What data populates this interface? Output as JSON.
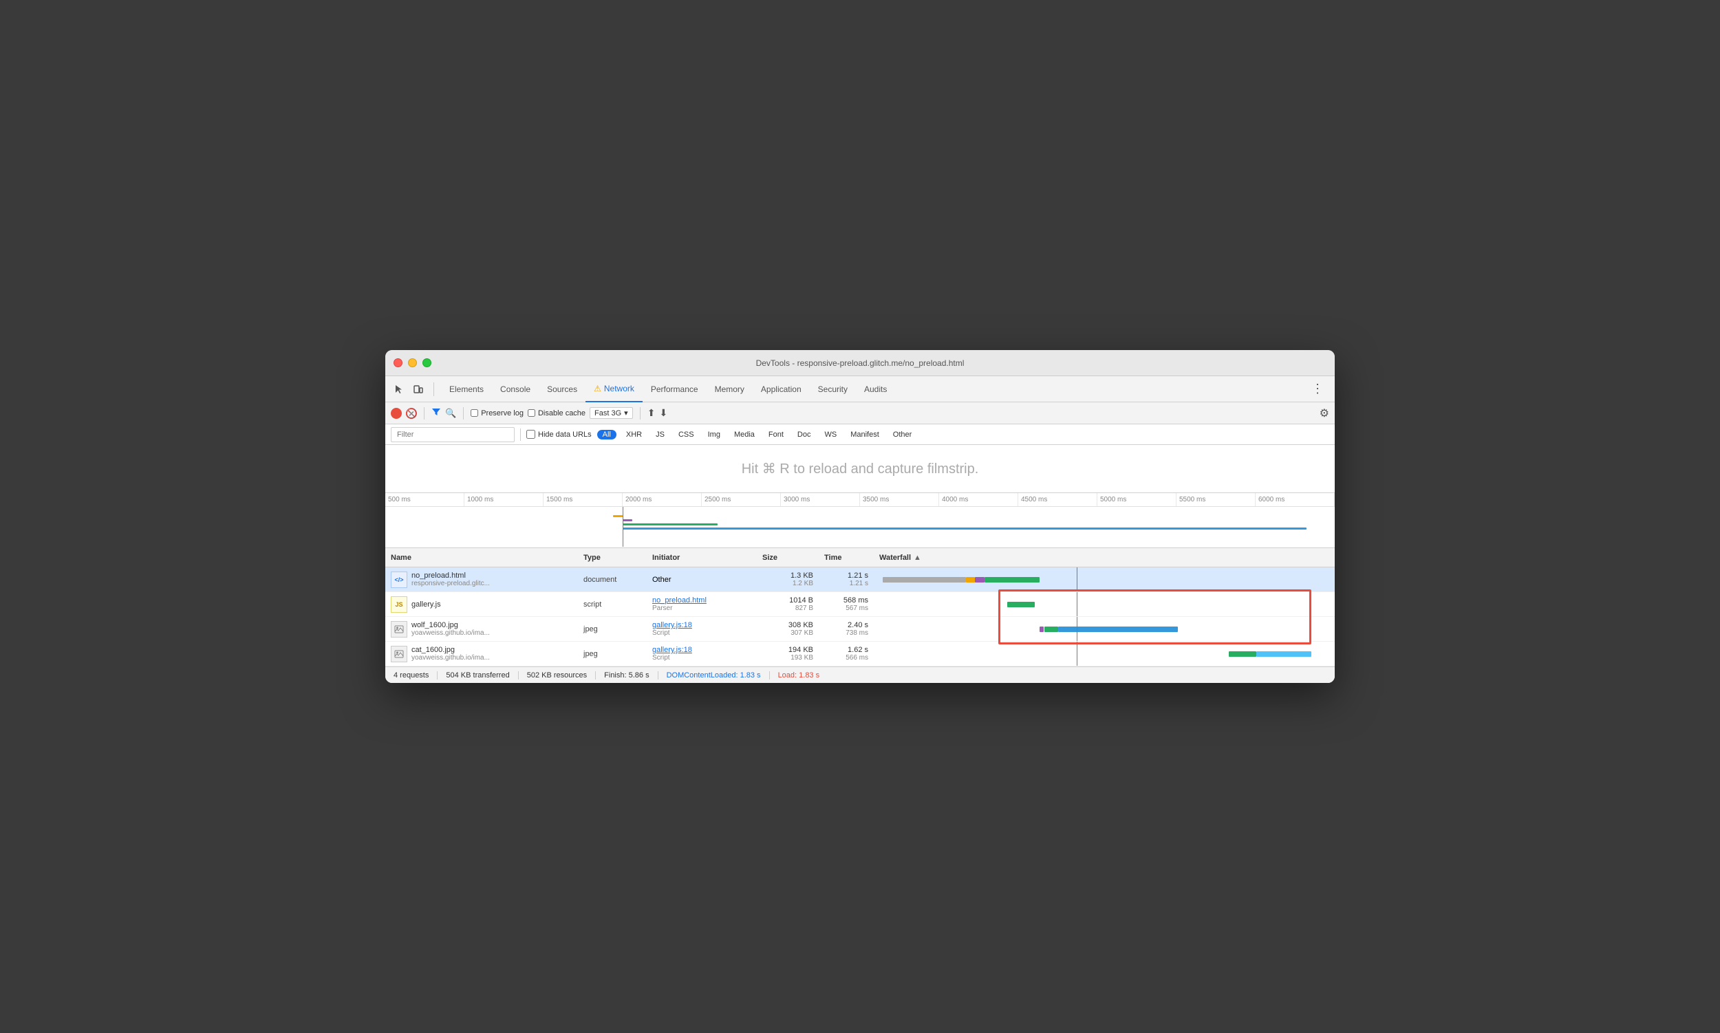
{
  "window": {
    "title": "DevTools - responsive-preload.glitch.me/no_preload.html"
  },
  "tabs": {
    "items": [
      {
        "label": "Elements",
        "active": false
      },
      {
        "label": "Console",
        "active": false
      },
      {
        "label": "Sources",
        "active": false
      },
      {
        "label": "Network",
        "active": true,
        "warning": true
      },
      {
        "label": "Performance",
        "active": false
      },
      {
        "label": "Memory",
        "active": false
      },
      {
        "label": "Application",
        "active": false
      },
      {
        "label": "Security",
        "active": false
      },
      {
        "label": "Audits",
        "active": false
      }
    ]
  },
  "toolbar": {
    "preserve_log": "Preserve log",
    "disable_cache": "Disable cache",
    "throttle": "Fast 3G",
    "filter_placeholder": "Filter"
  },
  "filter_types": [
    "All",
    "XHR",
    "JS",
    "CSS",
    "Img",
    "Media",
    "Font",
    "Doc",
    "WS",
    "Manifest",
    "Other"
  ],
  "filmstrip_hint": "Hit ⌘ R to reload and capture filmstrip.",
  "timeline_ticks": [
    "500 ms",
    "1000 ms",
    "1500 ms",
    "2000 ms",
    "2500 ms",
    "3000 ms",
    "3500 ms",
    "4000 ms",
    "4500 ms",
    "5000 ms",
    "5500 ms",
    "6000 ms"
  ],
  "table": {
    "headers": [
      "Name",
      "Type",
      "Initiator",
      "Size",
      "Time",
      "Waterfall"
    ],
    "rows": [
      {
        "name": "no_preload.html",
        "name_sub": "responsive-preload.glitc...",
        "type": "document",
        "initiator": "Other",
        "initiator_sub": "",
        "size": "1.3 KB",
        "size_sub": "1.2 KB",
        "time": "1.21 s",
        "time_sub": "1.21 s",
        "selected": true,
        "icon": "html"
      },
      {
        "name": "gallery.js",
        "name_sub": "",
        "type": "script",
        "initiator": "no_preload.html",
        "initiator_sub": "Parser",
        "size": "1014 B",
        "size_sub": "827 B",
        "time": "568 ms",
        "time_sub": "567 ms",
        "selected": false,
        "icon": "js"
      },
      {
        "name": "wolf_1600.jpg",
        "name_sub": "yoavweiss.github.io/ima...",
        "type": "jpeg",
        "initiator": "gallery.js:18",
        "initiator_sub": "Script",
        "size": "308 KB",
        "size_sub": "307 KB",
        "time": "2.40 s",
        "time_sub": "738 ms",
        "selected": false,
        "icon": "img"
      },
      {
        "name": "cat_1600.jpg",
        "name_sub": "yoavweiss.github.io/ima...",
        "type": "jpeg",
        "initiator": "gallery.js:18",
        "initiator_sub": "Script",
        "size": "194 KB",
        "size_sub": "193 KB",
        "time": "1.62 s",
        "time_sub": "566 ms",
        "selected": false,
        "icon": "img"
      }
    ]
  },
  "status": {
    "requests": "4 requests",
    "transferred": "504 KB transferred",
    "resources": "502 KB resources",
    "finish": "Finish: 5.86 s",
    "dom_content_loaded": "DOMContentLoaded: 1.83 s",
    "load": "Load: 1.83 s"
  }
}
